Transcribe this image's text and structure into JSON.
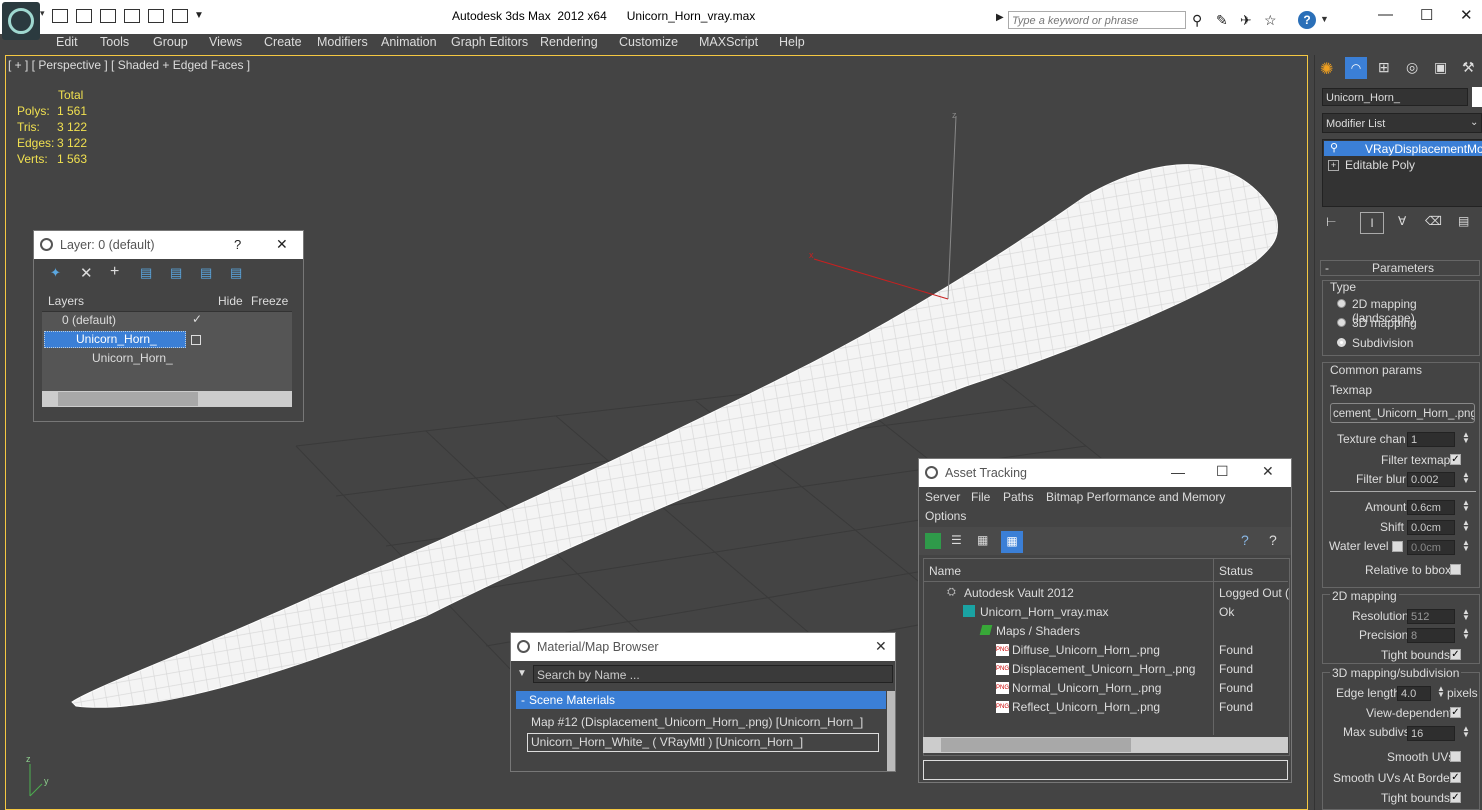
{
  "window": {
    "title": "Autodesk 3ds Max  2012 x64      Unicorn_Horn_vray.max",
    "search_placeholder": "Type a keyword or phrase",
    "help_label": "?"
  },
  "menu": [
    "Edit",
    "Tools",
    "Group",
    "Views",
    "Create",
    "Modifiers",
    "Animation",
    "Graph Editors",
    "Rendering",
    "Customize",
    "MAXScript",
    "Help"
  ],
  "viewport": {
    "label": "[ + ] [ Perspective ] [ Shaded + Edged Faces ]",
    "stats": {
      "header": "Total",
      "rows": [
        {
          "label": "Polys:",
          "value": "1 561"
        },
        {
          "label": "Tris:",
          "value": "3 122"
        },
        {
          "label": "Edges:",
          "value": "3 122"
        },
        {
          "label": "Verts:",
          "value": "1 563"
        }
      ]
    },
    "gizmo_x": "x",
    "gizmo_z": "z",
    "corner_z": "z",
    "corner_y": "y"
  },
  "layer_dialog": {
    "title": "Layer: 0 (default)",
    "help": "?",
    "columns": {
      "layers": "Layers",
      "hide": "Hide",
      "freeze": "Freeze"
    },
    "rows": [
      "0 (default)",
      "Unicorn_Horn_",
      "Unicorn_Horn_"
    ]
  },
  "asset_tracking": {
    "title": "Asset Tracking",
    "menus": [
      "Server",
      "File",
      "Paths",
      "Bitmap Performance and Memory",
      "Options"
    ],
    "columns": {
      "name": "Name",
      "status": "Status"
    },
    "rows": [
      {
        "name": "Autodesk Vault 2012",
        "status": "Logged Out (",
        "indent": 0
      },
      {
        "name": "Unicorn_Horn_vray.max",
        "status": "Ok",
        "indent": 1
      },
      {
        "name": "Maps / Shaders",
        "status": "",
        "indent": 2
      },
      {
        "name": "Diffuse_Unicorn_Horn_.png",
        "status": "Found",
        "indent": 3
      },
      {
        "name": "Displacement_Unicorn_Horn_.png",
        "status": "Found",
        "indent": 3
      },
      {
        "name": "Normal_Unicorn_Horn_.png",
        "status": "Found",
        "indent": 3
      },
      {
        "name": "Reflect_Unicorn_Horn_.png",
        "status": "Found",
        "indent": 3
      }
    ],
    "png_badge": "PNG"
  },
  "material_browser": {
    "title": "Material/Map Browser",
    "search_placeholder": "Search by Name ...",
    "group": "Scene Materials",
    "items": [
      "Map #12 (Displacement_Unicorn_Horn_.png)  [Unicorn_Horn_]",
      "Unicorn_Horn_White_  ( VRayMtl )  [Unicorn_Horn_]"
    ]
  },
  "command_panel": {
    "object_name": "Unicorn_Horn_",
    "modifier_list": "Modifier List",
    "stack": [
      "VRayDisplacementMod",
      "Editable Poly"
    ],
    "rollout_title": "Parameters",
    "type_label": "Type",
    "type_options": [
      "2D mapping (landscape)",
      "3D mapping",
      "Subdivision"
    ],
    "type_selected": 2,
    "common_params": "Common params",
    "texmap_label": "Texmap",
    "texmap_value": "cement_Unicorn_Horn_.png)",
    "texture_chan_label": "Texture chan",
    "texture_chan_value": "1",
    "filter_texmap": "Filter texmap",
    "filter_blur_label": "Filter blur",
    "filter_blur_value": "0.002",
    "amount_label": "Amount",
    "amount_value": "0.6cm",
    "shift_label": "Shift",
    "shift_value": "0.0cm",
    "water_level_label": "Water level",
    "water_level_value": "0.0cm",
    "relative_bbox": "Relative to bbox",
    "mapping2d_title": "2D mapping",
    "resolution_label": "Resolution",
    "resolution_value": "512",
    "precision_label": "Precision",
    "precision_value": "8",
    "tight_bounds": "Tight bounds",
    "mapping3d_title": "3D mapping/subdivision",
    "edge_length_label": "Edge length",
    "edge_length_value": "4.0",
    "pixels_label": "pixels",
    "view_dependent": "View-dependent",
    "max_subdivs_label": "Max subdivs",
    "max_subdivs_value": "16",
    "smooth_uvs": "Smooth UVs",
    "smooth_uvs_borders": "Smooth UVs At Borders",
    "tight_bounds2": "Tight bounds"
  },
  "colors": {
    "viewport_border": "#f5c842",
    "stats_text": "#f0e050",
    "selection": "#3b7fd6",
    "mesh": "#ffffff"
  }
}
